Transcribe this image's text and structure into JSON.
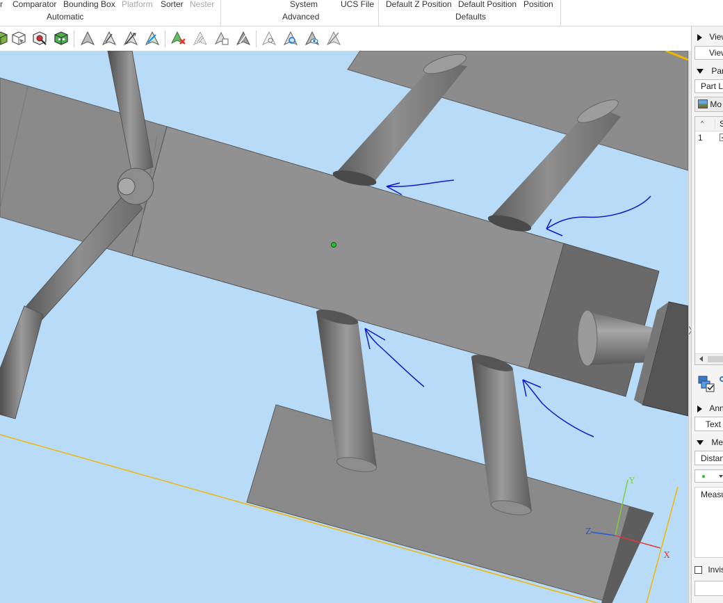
{
  "ribbon": {
    "automatic": {
      "label": "Automatic",
      "items": [
        {
          "label": "r",
          "disabled": false
        },
        {
          "label": "Comparator",
          "disabled": false
        },
        {
          "label": "Bounding Box",
          "disabled": false
        },
        {
          "label": "Platform",
          "disabled": true
        },
        {
          "label": "Sorter",
          "disabled": false
        },
        {
          "label": "Nester",
          "disabled": true
        }
      ]
    },
    "advanced": {
      "label": "Advanced",
      "items": [
        "System",
        "UCS File"
      ]
    },
    "defaults": {
      "label": "Defaults",
      "items": [
        "Default Z Position",
        "Default Position",
        "Position"
      ]
    }
  },
  "toolbar": {
    "icons": [
      "part-cube-icon",
      "wireframe-cube-icon",
      "cube-red-mark-icon",
      "cube-green-icon",
      "move-arrow-icon",
      "rotate-arrow-icon",
      "mirror-arrow-icon",
      "transform-arrow-icon",
      "delete-arrow-icon",
      "hatched-arrow-icon",
      "copy-arrow-icon",
      "solid-arrow-icon",
      "ghost-arrow-icon",
      "sync-arrow-icon",
      "visibility-arrow-icon",
      "hidden-arrow-icon"
    ]
  },
  "viewport": {
    "axes": {
      "x": "X",
      "y": "Y",
      "z": "Z"
    },
    "colors": {
      "background": "#b8dcf8",
      "annotation": "#0a1acc",
      "boundary": "#f2b400",
      "origin": "#2ac12a"
    }
  },
  "side_panel": {
    "view_label": "View",
    "view_button": "View",
    "part_label": "Part",
    "part_list_tab": "Part Li",
    "model_button": "Mo",
    "table": {
      "sort_col": "Se",
      "row_num": "1"
    },
    "annotation_label": "Ann",
    "text_button": "Text",
    "measure_label": "Me",
    "distance_tab": "Distan",
    "measure_field": "Measu",
    "invisible_label": "Invis"
  }
}
